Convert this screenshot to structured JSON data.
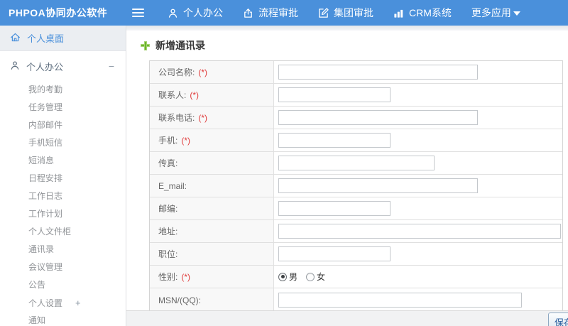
{
  "topbar": {
    "brand": "PHPOA协同办公软件",
    "nav_items": [
      {
        "label": "个人办公",
        "icon": "user-icon"
      },
      {
        "label": "流程审批",
        "icon": "flow-approval-icon"
      },
      {
        "label": "集团审批",
        "icon": "edit-approval-icon"
      },
      {
        "label": "CRM系统",
        "icon": "bar-chart-icon"
      },
      {
        "label": "更多应用",
        "icon": "caret-down-icon"
      }
    ]
  },
  "sidebar": {
    "desktop_label": "个人桌面",
    "section_label": "个人办公",
    "section_toggle": "−",
    "items": [
      "我的考勤",
      "任务管理",
      "内部邮件",
      "手机短信",
      "短消息",
      "日程安排",
      "工作日志",
      "工作计划",
      "个人文件柜",
      "通讯录",
      "会议管理",
      "公告"
    ],
    "settings_label": "个人设置",
    "settings_toggle": "+",
    "notice_label": "通知"
  },
  "main": {
    "title": "新增通讯录",
    "form": {
      "rows": [
        {
          "label": "公司名称:",
          "mark": "(*)",
          "value": ""
        },
        {
          "label": "联系人:",
          "mark": "(*)",
          "value": ""
        },
        {
          "label": "联系电话:",
          "mark": "(*)",
          "value": ""
        },
        {
          "label": "手机:",
          "mark": "(*)",
          "value": ""
        },
        {
          "label": "传真:",
          "mark": "",
          "value": ""
        },
        {
          "label": "E_mail:",
          "mark": "",
          "value": ""
        },
        {
          "label": "邮编:",
          "mark": "",
          "value": ""
        },
        {
          "label": "地址:",
          "mark": "",
          "value": ""
        },
        {
          "label": "职位:",
          "mark": "",
          "value": ""
        }
      ],
      "gender_row": {
        "label": "性别:",
        "mark": "(*)",
        "options": [
          {
            "label": "男",
            "checked": true
          },
          {
            "label": "女",
            "checked": false
          }
        ]
      },
      "msn_row": {
        "label": "MSN/(QQ):",
        "mark": "",
        "value": ""
      },
      "save_label": "保存"
    }
  },
  "colors": {
    "topbar_blue": "#4a90db",
    "accent_green": "#6cb52d",
    "required_red": "#e03c3c",
    "sidebar_active_bg": "#ebeef2"
  }
}
